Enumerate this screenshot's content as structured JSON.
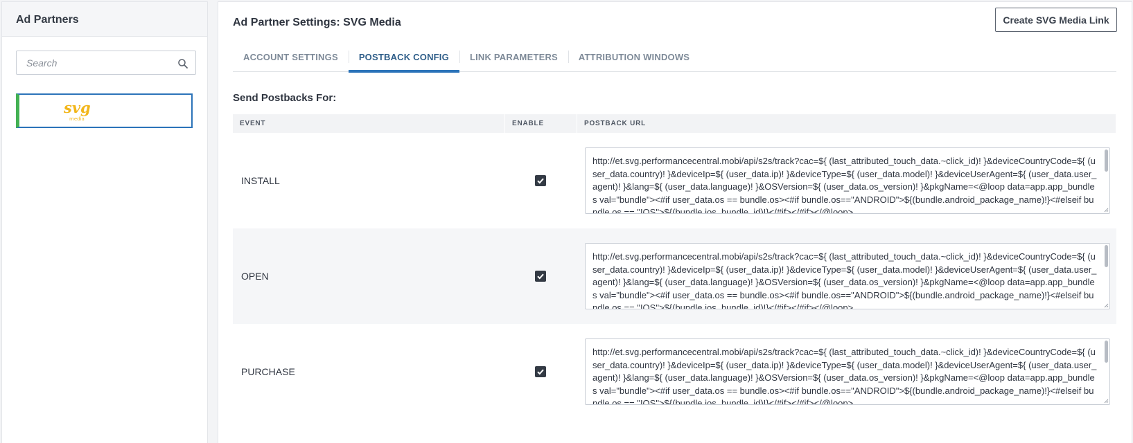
{
  "sidebar": {
    "title": "Ad Partners",
    "search_placeholder": "Search",
    "partner_logo_text": "svg",
    "partner_logo_subtext": "media",
    "logo_color": "#f2b61b"
  },
  "main": {
    "title": "Ad Partner Settings: SVG Media",
    "create_button_label": "Create SVG Media Link",
    "tabs": [
      {
        "label": "Account Settings",
        "active": false
      },
      {
        "label": "Postback Config",
        "active": true
      },
      {
        "label": "Link Parameters",
        "active": false
      },
      {
        "label": "Attribution Windows",
        "active": false
      }
    ],
    "section_heading": "Send Postbacks For:",
    "table": {
      "headers": {
        "event": "Event",
        "enable": "Enable",
        "url": "Postback URL"
      },
      "rows": [
        {
          "event": "INSTALL",
          "enabled": true,
          "url": "http://et.svg.performancecentral.mobi/api/s2s/track?cac=${ (last_attributed_touch_data.~click_id)! }&deviceCountryCode=${ (user_data.country)! }&deviceIp=${ (user_data.ip)! }&deviceType=${ (user_data.model)! }&deviceUserAgent=${ (user_data.user_agent)! }&lang=${ (user_data.language)! }&OSVersion=${ (user_data.os_version)! }&pkgName=<@loop data=app.app_bundles val=\"bundle\"><#if user_data.os == bundle.os><#if bundle.os==\"ANDROID\">${(bundle.android_package_name)!}<#elseif bundle.os == \"IOS\">${(bundle.ios_bundle_id)!}</#if></#if></@loop>"
        },
        {
          "event": "OPEN",
          "enabled": true,
          "url": "http://et.svg.performancecentral.mobi/api/s2s/track?cac=${ (last_attributed_touch_data.~click_id)! }&deviceCountryCode=${ (user_data.country)! }&deviceIp=${ (user_data.ip)! }&deviceType=${ (user_data.model)! }&deviceUserAgent=${ (user_data.user_agent)! }&lang=${ (user_data.language)! }&OSVersion=${ (user_data.os_version)! }&pkgName=<@loop data=app.app_bundles val=\"bundle\"><#if user_data.os == bundle.os><#if bundle.os==\"ANDROID\">${(bundle.android_package_name)!}<#elseif bundle.os == \"IOS\">${(bundle.ios_bundle_id)!}</#if></#if></@loop>"
        },
        {
          "event": "PURCHASE",
          "enabled": true,
          "url": "http://et.svg.performancecentral.mobi/api/s2s/track?cac=${ (last_attributed_touch_data.~click_id)! }&deviceCountryCode=${ (user_data.country)! }&deviceIp=${ (user_data.ip)! }&deviceType=${ (user_data.model)! }&deviceUserAgent=${ (user_data.user_agent)! }&lang=${ (user_data.language)! }&OSVersion=${ (user_data.os_version)! }&pkgName=<@loop data=app.app_bundles val=\"bundle\"><#if user_data.os == bundle.os><#if bundle.os==\"ANDROID\">${(bundle.android_package_name)!}<#elseif bundle.os == \"IOS\">${(bundle.ios_bundle_id)!}</#if></#if></@loop>"
        }
      ]
    }
  },
  "colors": {
    "accent": "#2b73b9",
    "selected_marker": "#43b153",
    "active_tab_text": "#2f5e89",
    "checkbox": "#333a44"
  },
  "icons": {
    "search": "search-icon",
    "checkbox": "checkmark-icon"
  }
}
